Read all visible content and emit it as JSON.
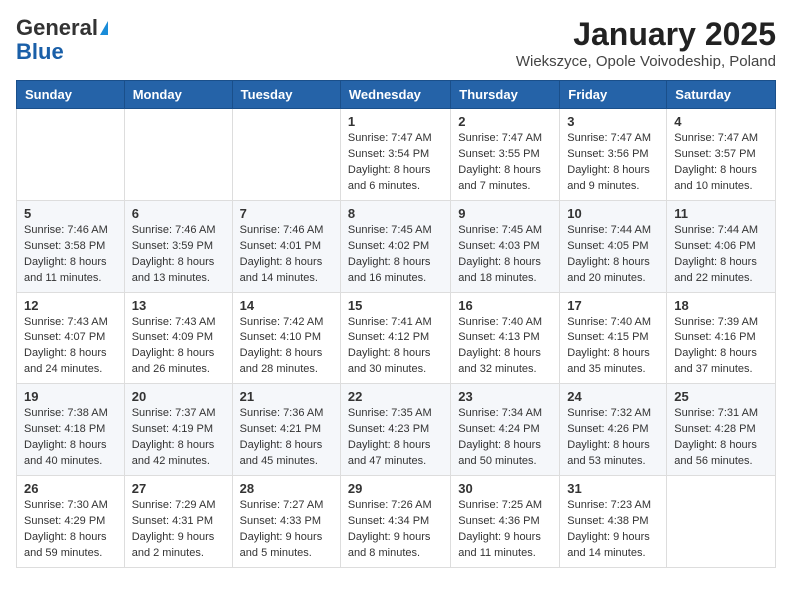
{
  "logo": {
    "general": "General",
    "blue": "Blue"
  },
  "title": "January 2025",
  "subtitle": "Wiekszyce, Opole Voivodeship, Poland",
  "days_of_week": [
    "Sunday",
    "Monday",
    "Tuesday",
    "Wednesday",
    "Thursday",
    "Friday",
    "Saturday"
  ],
  "weeks": [
    [
      {
        "day": "",
        "info": ""
      },
      {
        "day": "",
        "info": ""
      },
      {
        "day": "",
        "info": ""
      },
      {
        "day": "1",
        "info": "Sunrise: 7:47 AM\nSunset: 3:54 PM\nDaylight: 8 hours and 6 minutes."
      },
      {
        "day": "2",
        "info": "Sunrise: 7:47 AM\nSunset: 3:55 PM\nDaylight: 8 hours and 7 minutes."
      },
      {
        "day": "3",
        "info": "Sunrise: 7:47 AM\nSunset: 3:56 PM\nDaylight: 8 hours and 9 minutes."
      },
      {
        "day": "4",
        "info": "Sunrise: 7:47 AM\nSunset: 3:57 PM\nDaylight: 8 hours and 10 minutes."
      }
    ],
    [
      {
        "day": "5",
        "info": "Sunrise: 7:46 AM\nSunset: 3:58 PM\nDaylight: 8 hours and 11 minutes."
      },
      {
        "day": "6",
        "info": "Sunrise: 7:46 AM\nSunset: 3:59 PM\nDaylight: 8 hours and 13 minutes."
      },
      {
        "day": "7",
        "info": "Sunrise: 7:46 AM\nSunset: 4:01 PM\nDaylight: 8 hours and 14 minutes."
      },
      {
        "day": "8",
        "info": "Sunrise: 7:45 AM\nSunset: 4:02 PM\nDaylight: 8 hours and 16 minutes."
      },
      {
        "day": "9",
        "info": "Sunrise: 7:45 AM\nSunset: 4:03 PM\nDaylight: 8 hours and 18 minutes."
      },
      {
        "day": "10",
        "info": "Sunrise: 7:44 AM\nSunset: 4:05 PM\nDaylight: 8 hours and 20 minutes."
      },
      {
        "day": "11",
        "info": "Sunrise: 7:44 AM\nSunset: 4:06 PM\nDaylight: 8 hours and 22 minutes."
      }
    ],
    [
      {
        "day": "12",
        "info": "Sunrise: 7:43 AM\nSunset: 4:07 PM\nDaylight: 8 hours and 24 minutes."
      },
      {
        "day": "13",
        "info": "Sunrise: 7:43 AM\nSunset: 4:09 PM\nDaylight: 8 hours and 26 minutes."
      },
      {
        "day": "14",
        "info": "Sunrise: 7:42 AM\nSunset: 4:10 PM\nDaylight: 8 hours and 28 minutes."
      },
      {
        "day": "15",
        "info": "Sunrise: 7:41 AM\nSunset: 4:12 PM\nDaylight: 8 hours and 30 minutes."
      },
      {
        "day": "16",
        "info": "Sunrise: 7:40 AM\nSunset: 4:13 PM\nDaylight: 8 hours and 32 minutes."
      },
      {
        "day": "17",
        "info": "Sunrise: 7:40 AM\nSunset: 4:15 PM\nDaylight: 8 hours and 35 minutes."
      },
      {
        "day": "18",
        "info": "Sunrise: 7:39 AM\nSunset: 4:16 PM\nDaylight: 8 hours and 37 minutes."
      }
    ],
    [
      {
        "day": "19",
        "info": "Sunrise: 7:38 AM\nSunset: 4:18 PM\nDaylight: 8 hours and 40 minutes."
      },
      {
        "day": "20",
        "info": "Sunrise: 7:37 AM\nSunset: 4:19 PM\nDaylight: 8 hours and 42 minutes."
      },
      {
        "day": "21",
        "info": "Sunrise: 7:36 AM\nSunset: 4:21 PM\nDaylight: 8 hours and 45 minutes."
      },
      {
        "day": "22",
        "info": "Sunrise: 7:35 AM\nSunset: 4:23 PM\nDaylight: 8 hours and 47 minutes."
      },
      {
        "day": "23",
        "info": "Sunrise: 7:34 AM\nSunset: 4:24 PM\nDaylight: 8 hours and 50 minutes."
      },
      {
        "day": "24",
        "info": "Sunrise: 7:32 AM\nSunset: 4:26 PM\nDaylight: 8 hours and 53 minutes."
      },
      {
        "day": "25",
        "info": "Sunrise: 7:31 AM\nSunset: 4:28 PM\nDaylight: 8 hours and 56 minutes."
      }
    ],
    [
      {
        "day": "26",
        "info": "Sunrise: 7:30 AM\nSunset: 4:29 PM\nDaylight: 8 hours and 59 minutes."
      },
      {
        "day": "27",
        "info": "Sunrise: 7:29 AM\nSunset: 4:31 PM\nDaylight: 9 hours and 2 minutes."
      },
      {
        "day": "28",
        "info": "Sunrise: 7:27 AM\nSunset: 4:33 PM\nDaylight: 9 hours and 5 minutes."
      },
      {
        "day": "29",
        "info": "Sunrise: 7:26 AM\nSunset: 4:34 PM\nDaylight: 9 hours and 8 minutes."
      },
      {
        "day": "30",
        "info": "Sunrise: 7:25 AM\nSunset: 4:36 PM\nDaylight: 9 hours and 11 minutes."
      },
      {
        "day": "31",
        "info": "Sunrise: 7:23 AM\nSunset: 4:38 PM\nDaylight: 9 hours and 14 minutes."
      },
      {
        "day": "",
        "info": ""
      }
    ]
  ]
}
